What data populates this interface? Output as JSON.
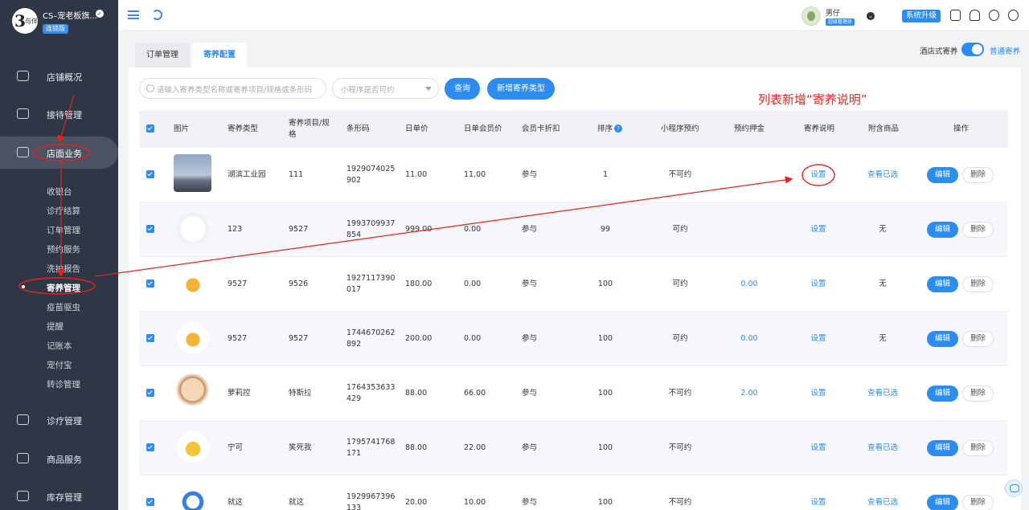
{
  "brand": {
    "logo_text": "3",
    "logo_sub": "与伴",
    "name": "CS–宠老板旗...",
    "edition": "连锁版"
  },
  "sidebar": {
    "main_items": [
      {
        "label": "店铺概况",
        "icon": "monitor-icon"
      },
      {
        "label": "接待管理",
        "icon": "clipboard-icon"
      },
      {
        "label": "店面业务",
        "icon": "store-icon"
      },
      {
        "label": "诊疗管理",
        "icon": "medical-icon"
      },
      {
        "label": "商品服务",
        "icon": "goods-icon"
      },
      {
        "label": "库存管理",
        "icon": "inventory-icon"
      }
    ],
    "sub_items": [
      "收银台",
      "诊疗结算",
      "订单管理",
      "预约服务",
      "洗护报告",
      "寄养管理",
      "疫苗驱虫",
      "提醒",
      "记账本",
      "宠付宝",
      "转诊管理"
    ],
    "active_main": "店面业务",
    "active_sub": "寄养管理"
  },
  "topbar": {
    "user_name": "男仔",
    "user_role": "超级管理员",
    "upgrade_label": "系统升级"
  },
  "tabs": [
    {
      "label": "订单管理",
      "active": false
    },
    {
      "label": "寄养配置",
      "active": true
    }
  ],
  "mode": {
    "label": "酒店式寄养",
    "alt_label": "普通寄养",
    "enabled": true
  },
  "filters": {
    "search_placeholder": "请输入寄养类型名称或寄养项目/规格或条形码",
    "select_placeholder": "小程序是否可约",
    "query_label": "查询",
    "add_label": "新增寄养类型"
  },
  "annotation": "列表新增“寄养说明”",
  "table": {
    "columns": [
      "图片",
      "寄养类型",
      "寄养项目/规格",
      "条形码",
      "日单价",
      "日单会员价",
      "会员卡折扣",
      "排序",
      "小程序预约",
      "预约押金",
      "寄养说明",
      "附含商品",
      "操作"
    ],
    "sort_help": "?",
    "rows": [
      {
        "type": "湖滨工业园",
        "spec": "111",
        "barcode": [
          "1929074025",
          "902"
        ],
        "price": "11.00",
        "member_price": "11.00",
        "discount": "参与",
        "sort": "1",
        "booking": "不可约",
        "deposit": "",
        "note": "设置",
        "goods": "查看已选"
      },
      {
        "type": "123",
        "spec": "9527",
        "barcode": [
          "1993709937",
          "854"
        ],
        "price": "999.00",
        "member_price": "0.00",
        "discount": "参与",
        "sort": "99",
        "booking": "可约",
        "deposit": "",
        "note": "设置",
        "goods": "无"
      },
      {
        "type": "9527",
        "spec": "9526",
        "barcode": [
          "1927117390",
          "017"
        ],
        "price": "180.00",
        "member_price": "0.00",
        "discount": "参与",
        "sort": "100",
        "booking": "可约",
        "deposit": "0.00",
        "note": "设置",
        "goods": "无"
      },
      {
        "type": "9527",
        "spec": "9527",
        "barcode": [
          "1744670262",
          "892"
        ],
        "price": "200.00",
        "member_price": "0.00",
        "discount": "参与",
        "sort": "100",
        "booking": "可约",
        "deposit": "0.00",
        "note": "设置",
        "goods": "无"
      },
      {
        "type": "萝莉控",
        "spec": "特斯拉",
        "barcode": [
          "1764353633",
          "429"
        ],
        "price": "88.00",
        "member_price": "66.00",
        "discount": "参与",
        "sort": "100",
        "booking": "不可约",
        "deposit": "2.00",
        "note": "设置",
        "goods": "查看已选"
      },
      {
        "type": "宁可",
        "spec": "笑死我",
        "barcode": [
          "1795741768",
          "171"
        ],
        "price": "88.00",
        "member_price": "22.00",
        "discount": "参与",
        "sort": "100",
        "booking": "不可约",
        "deposit": "",
        "note": "设置",
        "goods": "查看已选"
      },
      {
        "type": "就这",
        "spec": "就这",
        "barcode": [
          "1929967396",
          "133"
        ],
        "price": "20.00",
        "member_price": "10.00",
        "discount": "参与",
        "sort": "100",
        "booking": "不可约",
        "deposit": "",
        "note": "设置",
        "goods": "查看已选"
      }
    ],
    "edit_label": "编辑",
    "delete_label": "删除"
  },
  "colors": {
    "accent": "#2d8cf0",
    "sidebar_bg": "#2f3747",
    "annotation": "#e5231b"
  }
}
